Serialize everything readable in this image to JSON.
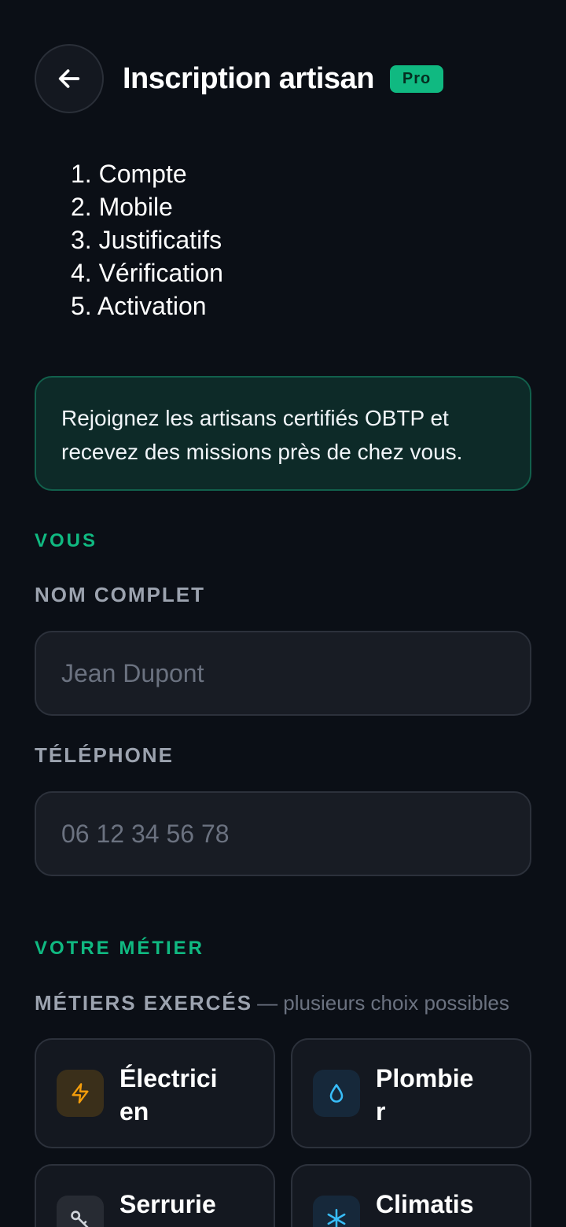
{
  "header": {
    "title": "Inscription artisan",
    "badge": "Pro"
  },
  "steps": [
    "1. Compte",
    "2. Mobile",
    "3. Justificatifs",
    "4. Vérification",
    "5. Activation"
  ],
  "info_text": "Rejoignez les artisans certifiés OBTP et recevez des missions près de chez vous.",
  "section_you": {
    "title": "VOUS",
    "name_label": "NOM COMPLET",
    "name_placeholder": "Jean Dupont",
    "phone_label": "TÉLÉPHONE",
    "phone_placeholder": "06 12 34 56 78"
  },
  "section_trade": {
    "title": "VOTRE MÉTIER",
    "trades_label": "MÉTIERS EXERCÉS",
    "trades_hint": "— plusieurs choix possibles",
    "trades": [
      {
        "label": "Électricien",
        "icon": "lightning-icon",
        "color": "#f59e0b"
      },
      {
        "label": "Plombier",
        "icon": "water-drop-icon",
        "color": "#38bdf8"
      },
      {
        "label": "Serrurier",
        "icon": "key-icon",
        "color": "#9ca3af"
      },
      {
        "label": "Climatisation",
        "icon": "snowflake-icon",
        "color": "#38bdf8"
      }
    ]
  },
  "colors": {
    "accent": "#10b981",
    "background": "#0b0f16"
  }
}
